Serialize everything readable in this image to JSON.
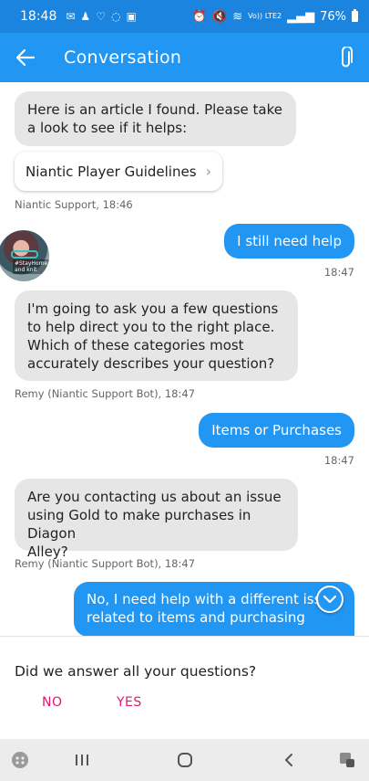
{
  "status_bar": {
    "time": "18:48",
    "network": "Vo)) LTE2",
    "battery": "76%"
  },
  "app_bar": {
    "title": "Conversation"
  },
  "messages": {
    "m1": {
      "text_line1": "Here is an article I found. Please take",
      "text_line2": "a look to see if it helps:",
      "link_label": "Niantic Player Guidelines",
      "meta": "Niantic Support, 18:46"
    },
    "m2": {
      "text": "I still need help",
      "time": "18:47",
      "avatar_text": "#StayHome and knit"
    },
    "m3": {
      "line1": "I'm going to ask you a few questions",
      "line2": "to help direct you to the right place.",
      "line3": "Which of these categories most",
      "line4": "accurately describes your question?",
      "meta": "Remy (Niantic Support Bot), 18:47"
    },
    "m4": {
      "text": "Items or Purchases",
      "time": "18:47"
    },
    "m5": {
      "line1": "Are you contacting us about an issue",
      "line2": "using Gold to make purchases in Diagon",
      "line3": "Alley?",
      "meta": "Remy (Niantic Support Bot), 18:47"
    },
    "m6": {
      "line1": "No, I need help with a different iss",
      "line2": "related to items and purchasing"
    }
  },
  "feedback": {
    "question": "Did we answer all your questions?",
    "no_label": "NO",
    "yes_label": "YES"
  },
  "colors": {
    "status_bar": "#1a84de",
    "app_bar": "#2196f3",
    "outgoing_bubble": "#2196f3",
    "incoming_bubble": "#e6e6e6",
    "feedback_action": "#e0186c"
  }
}
